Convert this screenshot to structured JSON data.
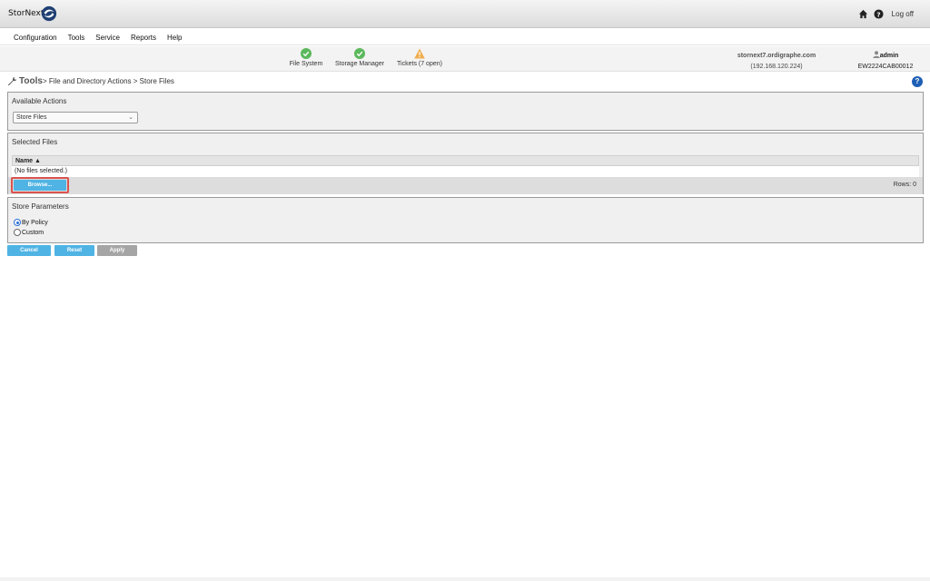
{
  "app": {
    "logo_text": "StorNext",
    "logoff_label": "Log off"
  },
  "menu": [
    "Configuration",
    "Tools",
    "Service",
    "Reports",
    "Help"
  ],
  "status": [
    {
      "label": "File System",
      "state": "ok",
      "icon": "check-circle-icon"
    },
    {
      "label": "Storage Manager",
      "state": "ok",
      "icon": "check-circle-icon"
    },
    {
      "label": "Tickets (7 open)",
      "state": "warning",
      "icon": "warning-triangle-icon"
    }
  ],
  "host": {
    "name": "stornext7.ordigraphe.com",
    "ip": "(192.168.120.224)"
  },
  "user": {
    "name": "admin",
    "serial": "EW2224CAB00012"
  },
  "breadcrumb": {
    "root": "Tools",
    "path": "> File and Directory Actions > Store Files"
  },
  "available_actions": {
    "title": "Available Actions",
    "selected": "Store Files"
  },
  "selected_files": {
    "title": "Selected Files",
    "column": "Name ▲",
    "empty_text": "(No files selected.)",
    "browse_label": "Browse...",
    "rows_label": "Rows: 0"
  },
  "store_parameters": {
    "title": "Store Parameters",
    "options": [
      {
        "label": "By Policy",
        "checked": true
      },
      {
        "label": "Custom",
        "checked": false
      }
    ]
  },
  "buttons": {
    "cancel": "Cancel",
    "reset": "Reset",
    "apply": "Apply"
  },
  "colors": {
    "ok": "#5cb85c",
    "warning": "#f0ad4e",
    "button_blue": "#4fb3e4",
    "button_disabled": "#a5a5a5",
    "highlight": "#d9534f"
  }
}
